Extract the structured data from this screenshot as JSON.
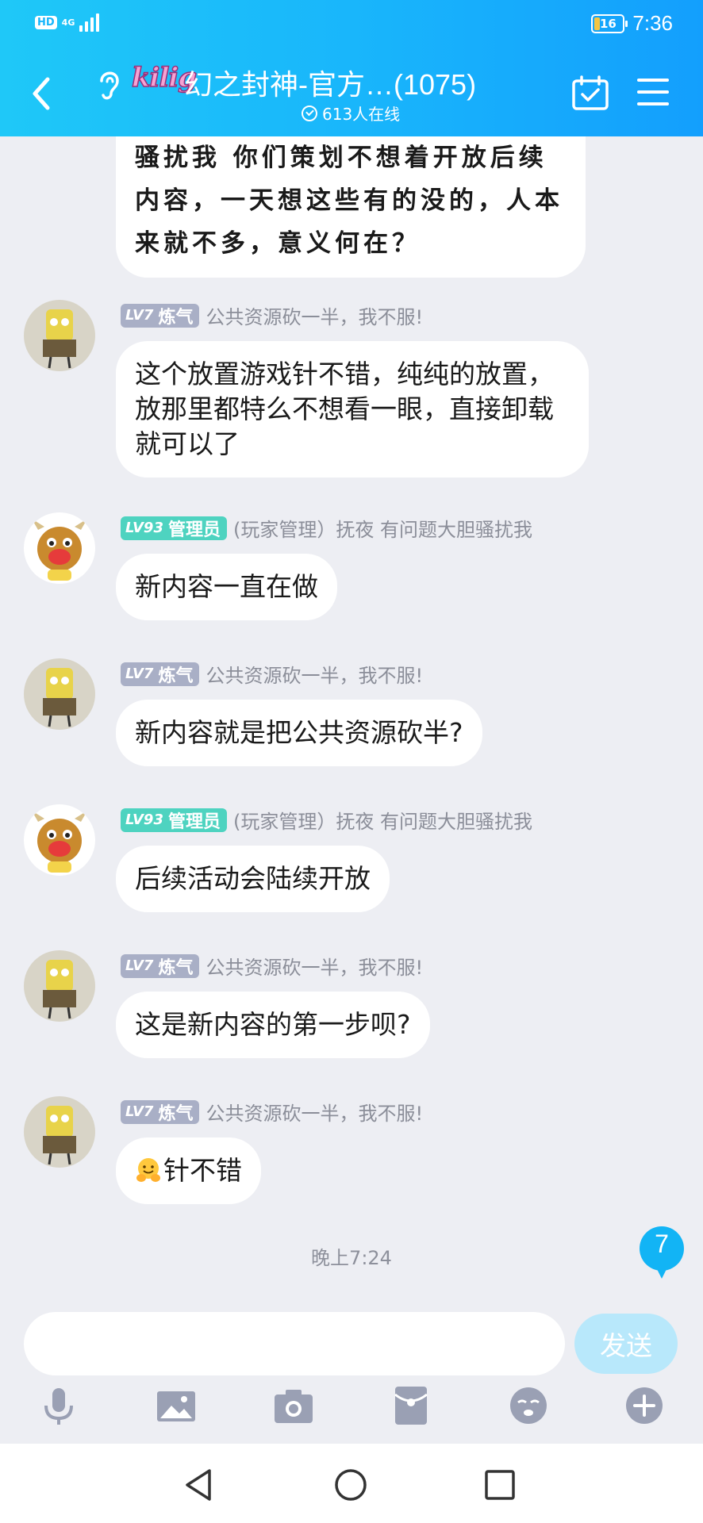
{
  "status_bar": {
    "hd": "HD",
    "network": "4G",
    "battery": "16",
    "time": "7:36"
  },
  "header": {
    "logo_text": "kilig",
    "title": "幻之封神-官方…(1075)",
    "online": "613人在线"
  },
  "messages": [
    {
      "type": "continued",
      "text": "骚扰我 你们策划不想着开放后续内容，一天想这些有的没的，人本来就不多，意义何在？"
    },
    {
      "level": "LV7",
      "title": "炼气",
      "name": "公共资源砍一半，我不服!",
      "text": "这个放置游戏针不错，纯纯的放置，放那里都特么不想看一眼，直接卸载就可以了"
    },
    {
      "level": "LV93",
      "title": "管理员",
      "name": "(玩家管理）抚夜  有问题大胆骚扰我",
      "text": "新内容一直在做"
    },
    {
      "level": "LV7",
      "title": "炼气",
      "name": "公共资源砍一半，我不服!",
      "text": "新内容就是把公共资源砍半?"
    },
    {
      "level": "LV93",
      "title": "管理员",
      "name": "(玩家管理）抚夜  有问题大胆骚扰我",
      "text": "后续活动会陆续开放"
    },
    {
      "level": "LV7",
      "title": "炼气",
      "name": "公共资源砍一半，我不服!",
      "text": "这是新内容的第一步呗?"
    },
    {
      "level": "LV7",
      "title": "炼气",
      "name": "公共资源砍一半，我不服!",
      "text": "针不错",
      "emoji": "smiling-hands-emoji"
    }
  ],
  "timestamp": "晚上7:24",
  "unread_count": "7",
  "input": {
    "placeholder": "",
    "send_label": "发送"
  },
  "toolbar": [
    "microphone-icon",
    "image-icon",
    "camera-icon",
    "red-packet-icon",
    "emoji-icon",
    "plus-icon"
  ],
  "colors": {
    "header_gradient_start": "#1fc8f8",
    "header_gradient_end": "#139ffd",
    "chat_background": "#edeef3",
    "level_badge_gray": "#a9afc6",
    "level_badge_admin": "#4ed3c0",
    "send_button": "#b8e8fb",
    "unread_badge": "#12b4f5"
  }
}
